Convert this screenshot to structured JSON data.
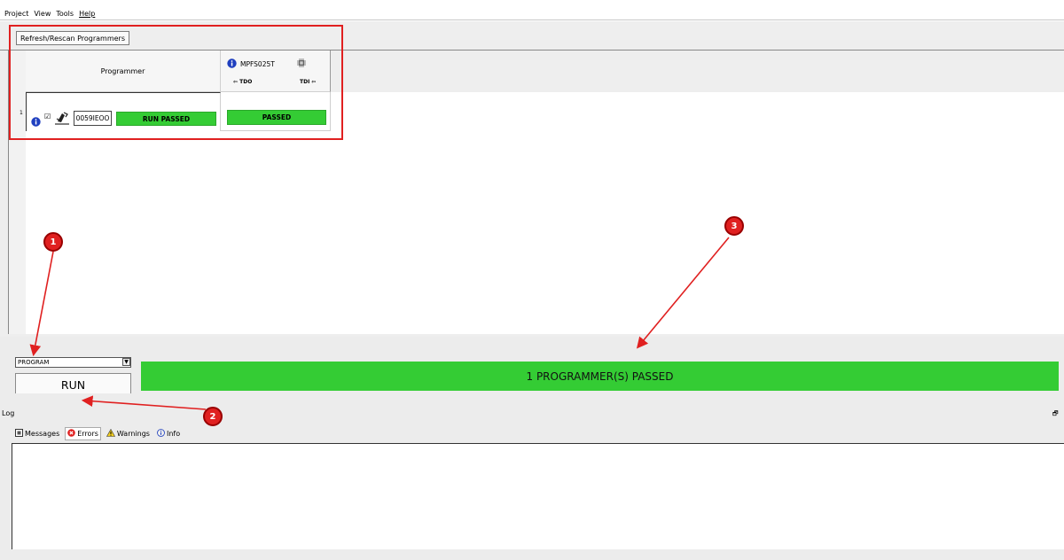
{
  "menu": {
    "items": [
      "Project",
      "View",
      "Tools",
      "Help"
    ]
  },
  "toolbar": {
    "refresh_label": "Refresh/Rescan Programmers"
  },
  "grid": {
    "programmer_header": "Programmer",
    "device": {
      "name": "MPFS025T",
      "tdo_label": "⇦ TDO",
      "tdi_label": "TDI ⇦"
    },
    "rows": [
      {
        "number": "1",
        "checked": "☑",
        "serial": "0059IEOO",
        "programmer_status": "RUN PASSED",
        "device_status": "PASSED"
      }
    ]
  },
  "controls": {
    "action_selected": "PROGRAM",
    "run_label": "RUN",
    "result_text": "1 PROGRAMMER(S) PASSED"
  },
  "log": {
    "title": "Log",
    "tabs": [
      {
        "label": "Messages",
        "icon": "messages-icon"
      },
      {
        "label": "Errors",
        "icon": "error-icon"
      },
      {
        "label": "Warnings",
        "icon": "warning-icon"
      },
      {
        "label": "Info",
        "icon": "info-icon"
      }
    ]
  },
  "annotations": {
    "badges": [
      "1",
      "2",
      "3"
    ]
  },
  "colors": {
    "success": "#34cc34",
    "annotation": "#e02020",
    "info_blue": "#1f3fbf"
  }
}
